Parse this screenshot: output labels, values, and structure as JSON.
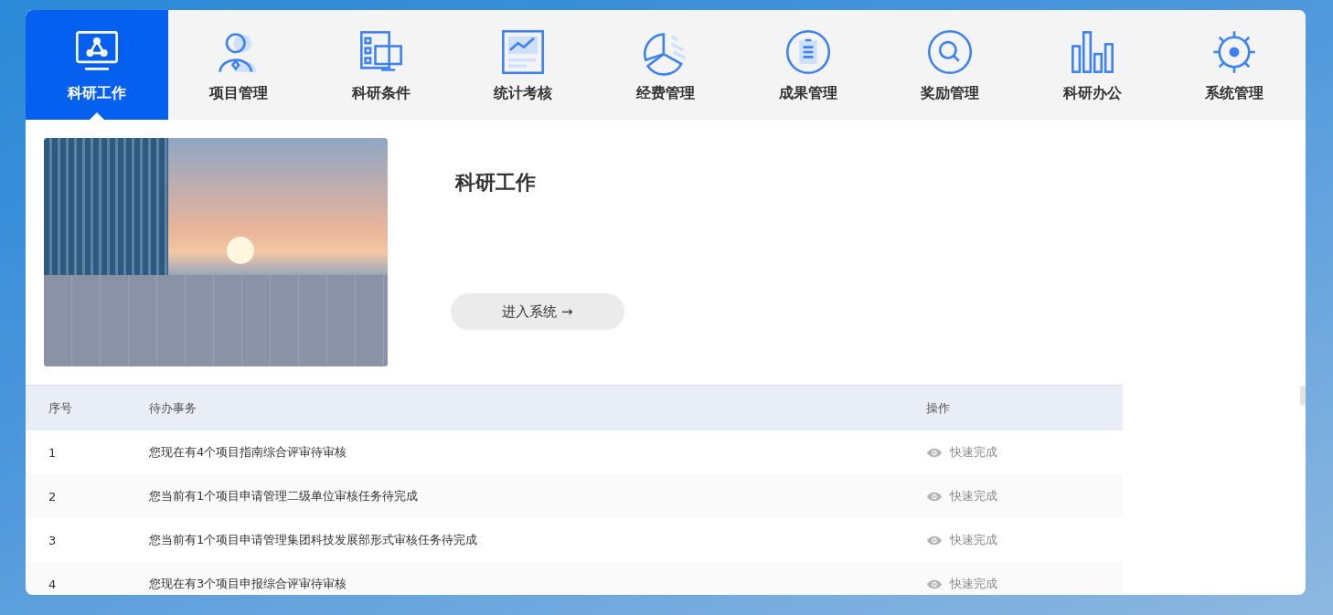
{
  "nav_tabs": [
    {
      "label": "科研工作",
      "selected": true
    },
    {
      "label": "项目管理",
      "selected": false
    },
    {
      "label": "科研条件",
      "selected": false
    },
    {
      "label": "统计考核",
      "selected": false
    },
    {
      "label": "经费管理",
      "selected": false
    },
    {
      "label": "成果管理",
      "selected": false
    },
    {
      "label": "奖励管理",
      "selected": false
    },
    {
      "label": "科研办公",
      "selected": false
    },
    {
      "label": "系统管理",
      "selected": false
    }
  ],
  "intro": {
    "title": "科研工作",
    "button": "进入系统 →"
  },
  "table": {
    "columns": [
      "序号",
      "待办事务",
      "操作"
    ],
    "rows": [
      {
        "index": "1",
        "task": "您现在有4个项目指南综合评审待审核",
        "action": "快速完成"
      },
      {
        "index": "2",
        "task": "您当前有1个项目申请管理二级单位审核任务待完成",
        "action": "快速完成"
      },
      {
        "index": "3",
        "task": "您当前有1个项目申请管理集团科技发展部形式审核任务待完成",
        "action": "快速完成"
      },
      {
        "index": "4",
        "task": "您现在有3个项目申报综合评审待审核",
        "action": "快速完成"
      }
    ]
  }
}
